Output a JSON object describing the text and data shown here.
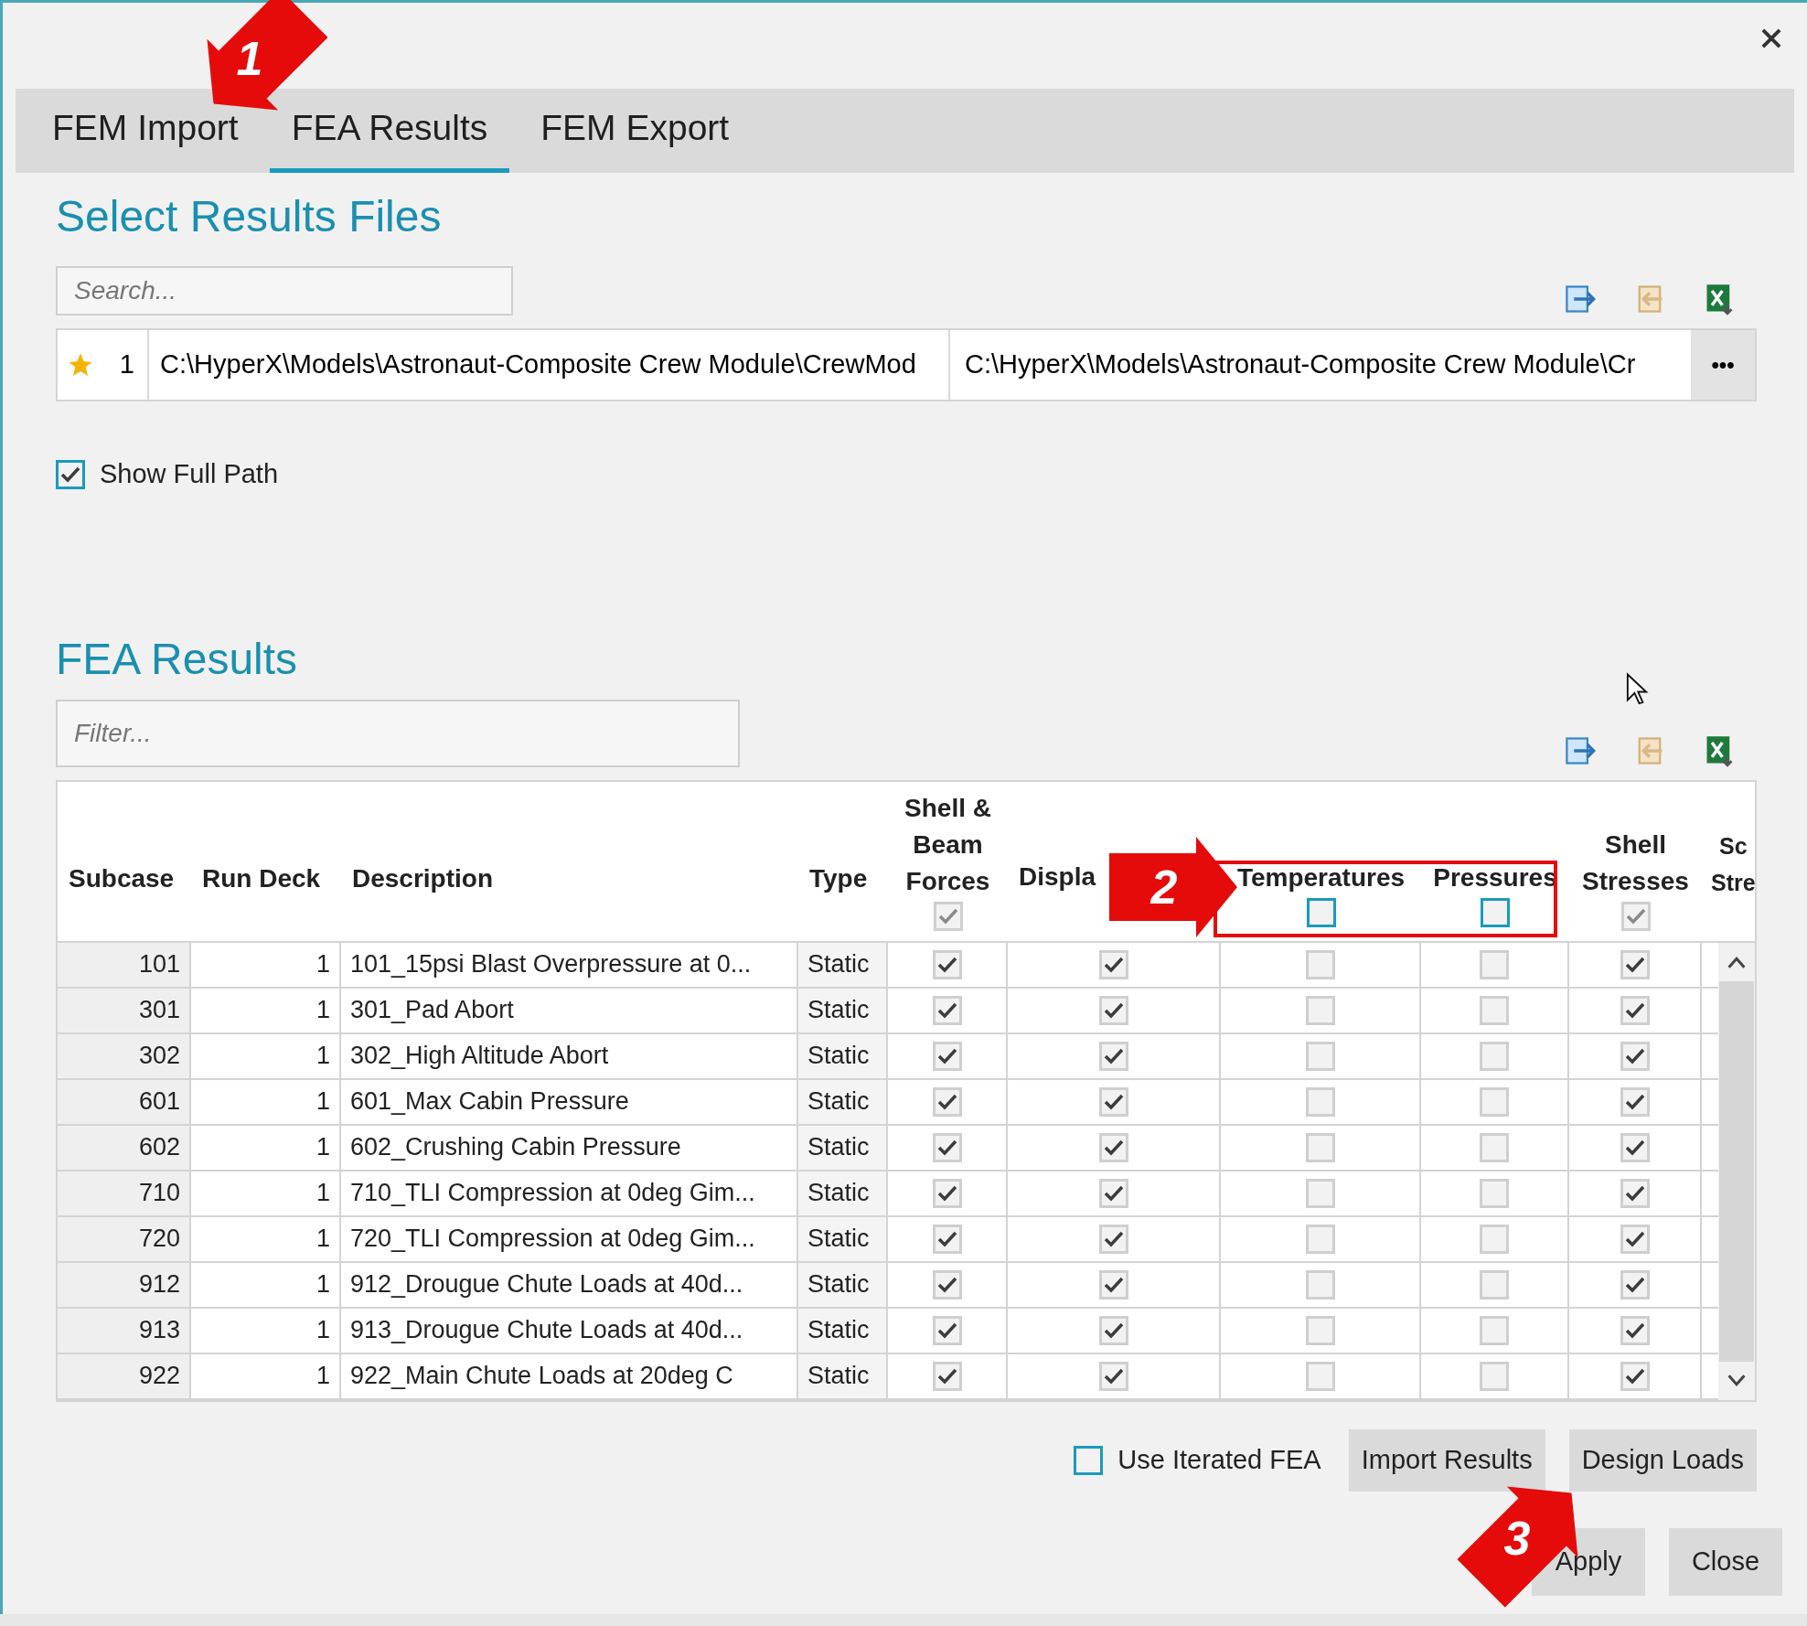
{
  "tabs": [
    {
      "label": "FEM Import",
      "selected": false
    },
    {
      "label": "FEA Results",
      "selected": true
    },
    {
      "label": "FEM Export",
      "selected": false
    }
  ],
  "files_section": {
    "title": "Select Results Files",
    "search": {
      "placeholder": "Search..."
    },
    "files": [
      {
        "starred": true,
        "index": "1",
        "path": "C:\\HyperX\\Models\\Astronaut-Composite Crew Module\\CrewMod",
        "path_2": "C:\\HyperX\\Models\\Astronaut-Composite Crew Module\\Cr",
        "more": "•••"
      }
    ],
    "show_full_path": {
      "label": "Show Full Path",
      "checked": true
    }
  },
  "results_section": {
    "title": "FEA Results",
    "filter": {
      "placeholder": "Filter..."
    },
    "columns": [
      {
        "kind": "text",
        "lines": [
          "Subcase"
        ]
      },
      {
        "kind": "text",
        "lines": [
          "Run Deck"
        ]
      },
      {
        "kind": "text",
        "lines": [
          "Description"
        ]
      },
      {
        "kind": "text",
        "lines": [
          "Type"
        ]
      },
      {
        "kind": "check",
        "lines": [
          "Shell &",
          "Beam",
          "Forces"
        ],
        "header_checked": true
      },
      {
        "kind": "check",
        "lines": [
          "Displa"
        ]
      },
      {
        "kind": "check",
        "lines": [
          "Temperatures"
        ],
        "header_checked": false
      },
      {
        "kind": "check",
        "lines": [
          "Pressures"
        ],
        "header_checked": false
      },
      {
        "kind": "check",
        "lines": [
          "Shell",
          "Stresses"
        ],
        "header_checked": true
      },
      {
        "kind": "cut",
        "lines": [
          "Sc",
          "Stre"
        ]
      }
    ],
    "rows": [
      {
        "cells": [
          "101",
          "1",
          "101_15psi Blast Overpressure at 0...",
          "Static"
        ],
        "checks": [
          true,
          true,
          false,
          false,
          true
        ]
      },
      {
        "cells": [
          "301",
          "1",
          "301_Pad Abort",
          "Static"
        ],
        "checks": [
          true,
          true,
          false,
          false,
          true
        ]
      },
      {
        "cells": [
          "302",
          "1",
          "302_High Altitude Abort",
          "Static"
        ],
        "checks": [
          true,
          true,
          false,
          false,
          true
        ]
      },
      {
        "cells": [
          "601",
          "1",
          "601_Max Cabin Pressure",
          "Static"
        ],
        "checks": [
          true,
          true,
          false,
          false,
          true
        ]
      },
      {
        "cells": [
          "602",
          "1",
          "602_Crushing Cabin Pressure",
          "Static"
        ],
        "checks": [
          true,
          true,
          false,
          false,
          true
        ]
      },
      {
        "cells": [
          "710",
          "1",
          "710_TLI Compression at 0deg Gim...",
          "Static"
        ],
        "checks": [
          true,
          true,
          false,
          false,
          true
        ]
      },
      {
        "cells": [
          "720",
          "1",
          "720_TLI Compression at 0deg Gim...",
          "Static"
        ],
        "checks": [
          true,
          true,
          false,
          false,
          true
        ]
      },
      {
        "cells": [
          "912",
          "1",
          "912_Drougue Chute Loads at 40d...",
          "Static"
        ],
        "checks": [
          true,
          true,
          false,
          false,
          true
        ]
      },
      {
        "cells": [
          "913",
          "1",
          "913_Drougue Chute Loads at 40d...",
          "Static"
        ],
        "checks": [
          true,
          true,
          false,
          false,
          true
        ]
      },
      {
        "cells": [
          "922",
          "1",
          "922_Main Chute Loads at 20deg C",
          "Static"
        ],
        "checks": [
          true,
          true,
          false,
          false,
          true
        ]
      }
    ],
    "use_iterated_fea": {
      "label": "Use Iterated FEA",
      "checked": false
    },
    "buttons": [
      "Import Results",
      "Design Loads"
    ]
  },
  "footer_buttons": [
    "Apply",
    "Close"
  ],
  "callouts": [
    "1",
    "2",
    "3"
  ]
}
